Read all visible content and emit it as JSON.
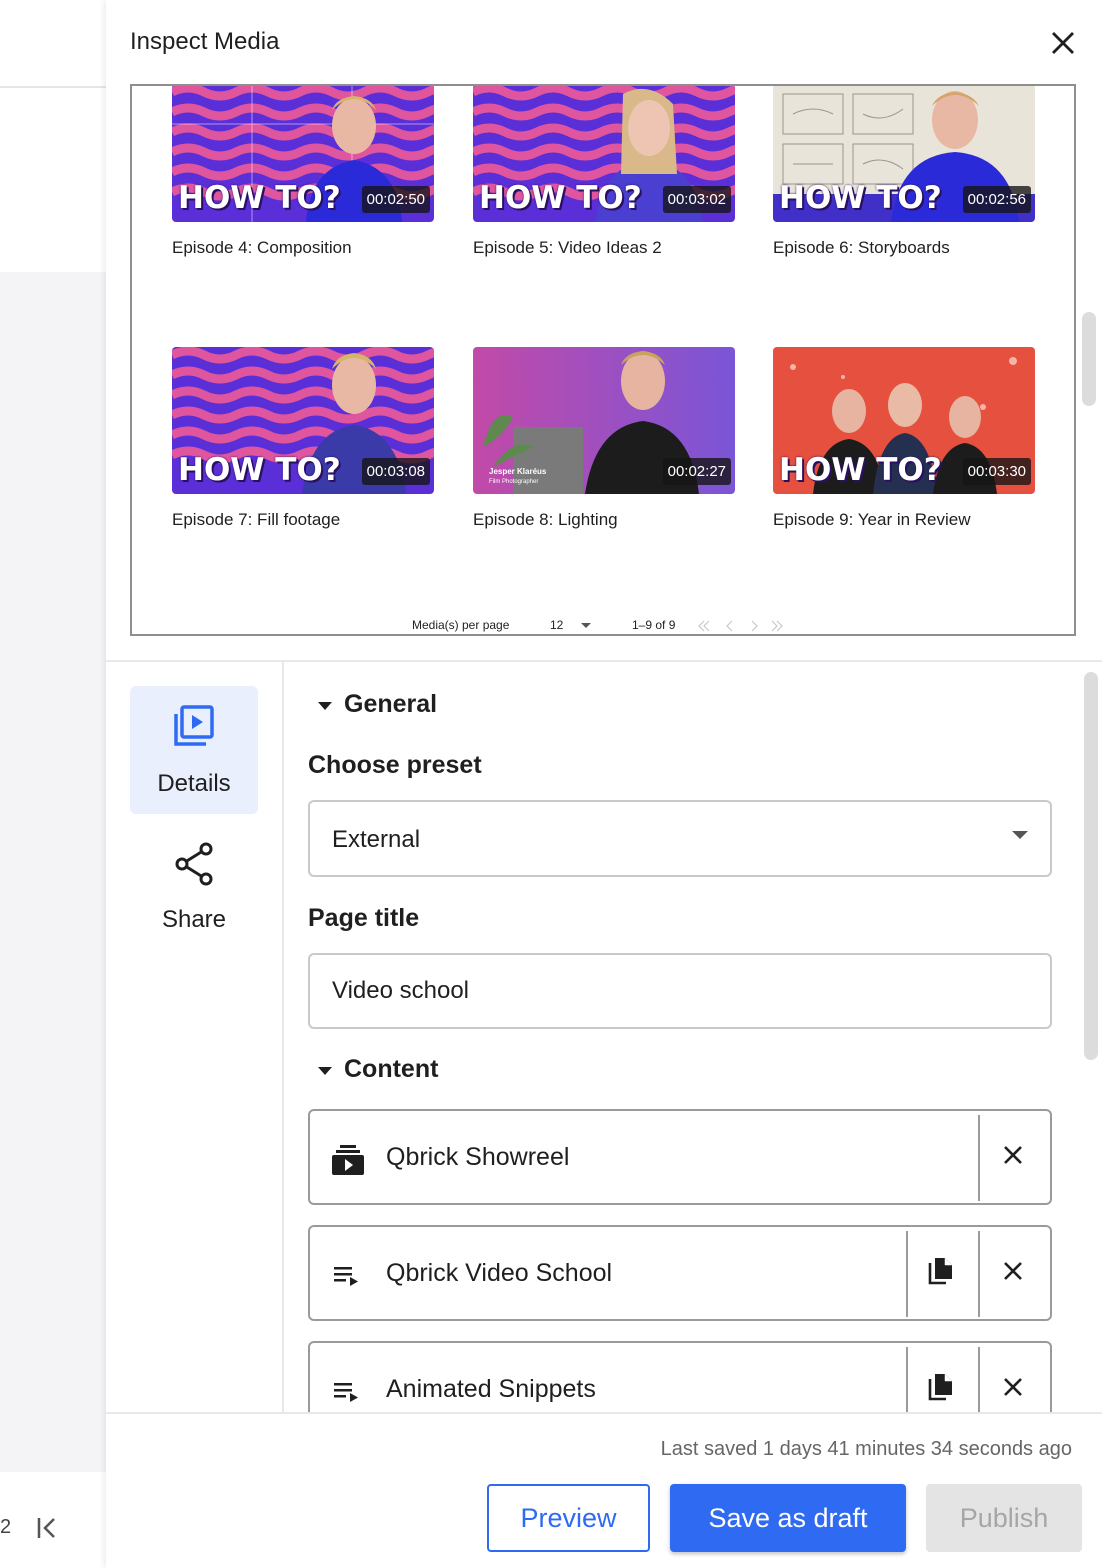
{
  "background": {
    "page_number": "2"
  },
  "panel": {
    "title": "Inspect Media"
  },
  "media": {
    "items": [
      {
        "title": "Episode 4: Composition",
        "duration": "00:02:50",
        "overlay": "HOW TO?"
      },
      {
        "title": "Episode 5: Video Ideas 2",
        "duration": "00:03:02",
        "overlay": "HOW TO?"
      },
      {
        "title": "Episode 6: Storyboards",
        "duration": "00:02:56",
        "overlay": "HOW TO?"
      },
      {
        "title": "Episode 7: Fill footage",
        "duration": "00:03:08",
        "overlay": "HOW TO?"
      },
      {
        "title": "Episode 8: Lighting",
        "duration": "00:02:27",
        "overlay": "",
        "caption_name": "Jesper Klaréus",
        "caption_role": "Film Photographer"
      },
      {
        "title": "Episode 9: Year in Review",
        "duration": "00:03:30",
        "overlay": "HOW TO?"
      }
    ],
    "pagination": {
      "per_page_label": "Media(s) per page",
      "per_page_value": "12",
      "range": "1–9 of 9"
    }
  },
  "nav": {
    "details_label": "Details",
    "share_label": "Share"
  },
  "form": {
    "general_header": "General",
    "preset_label": "Choose preset",
    "preset_value": "External",
    "page_title_label": "Page title",
    "page_title_value": "Video school",
    "content_header": "Content",
    "content_items": [
      {
        "name": "Qbrick Showreel",
        "type": "video"
      },
      {
        "name": "Qbrick Video School",
        "type": "playlist"
      },
      {
        "name": "Animated Snippets",
        "type": "playlist"
      }
    ]
  },
  "footer": {
    "last_saved": "Last saved 1 days 41 minutes 34 seconds ago",
    "preview_label": "Preview",
    "draft_label": "Save as draft",
    "publish_label": "Publish"
  },
  "colors": {
    "accent": "#2f6bf2",
    "wave_pink": "#e0569e",
    "wave_purple": "#5b2fd8",
    "nav_active_bg": "#e9effc"
  }
}
